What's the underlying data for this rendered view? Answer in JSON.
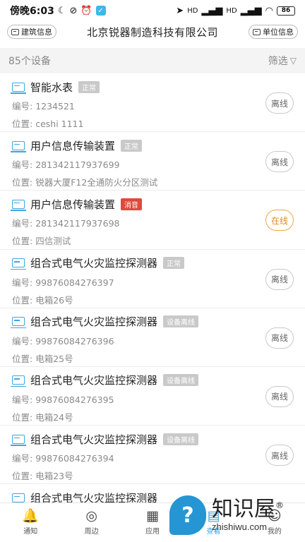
{
  "status_bar": {
    "time": "傍晚6:03",
    "battery": "86",
    "net1": "HD",
    "net2": "HD"
  },
  "header": {
    "left_button": "建筑信息",
    "title": "北京锐器制造科技有限公司",
    "right_button": "单位信息"
  },
  "filter": {
    "count_label": "85个设备",
    "filter_label": "筛选"
  },
  "devices": [
    {
      "name": "智能水表",
      "state": "正常",
      "state_type": "normal",
      "code_label": "编号:",
      "code": "1234521",
      "loc_label": "位置:",
      "location": "ceshi 1111",
      "online": "离线",
      "online_type": "off"
    },
    {
      "name": "用户信息传输装置",
      "state": "正常",
      "state_type": "normal",
      "code_label": "编号:",
      "code": "281342117937699",
      "loc_label": "位置:",
      "location": "锐器大厦F12全通防火分区测试",
      "online": "离线",
      "online_type": "off"
    },
    {
      "name": "用户信息传输装置",
      "state": "消音",
      "state_type": "alarm",
      "code_label": "编号:",
      "code": "281342117937698",
      "loc_label": "位置:",
      "location": "四信测试",
      "online": "在线",
      "online_type": "on"
    },
    {
      "name": "组合式电气火灾监控探测器",
      "state": "正常",
      "state_type": "normal",
      "code_label": "编号:",
      "code": "99876084276397",
      "loc_label": "位置:",
      "location": "电箱26号",
      "online": "离线",
      "online_type": "off"
    },
    {
      "name": "组合式电气火灾监控探测器",
      "state": "设备离线",
      "state_type": "normal",
      "code_label": "编号:",
      "code": "99876084276396",
      "loc_label": "位置:",
      "location": "电箱25号",
      "online": "离线",
      "online_type": "off"
    },
    {
      "name": "组合式电气火灾监控探测器",
      "state": "设备离线",
      "state_type": "normal",
      "code_label": "编号:",
      "code": "99876084276395",
      "loc_label": "位置:",
      "location": "电箱24号",
      "online": "离线",
      "online_type": "off"
    },
    {
      "name": "组合式电气火灾监控探测器",
      "state": "设备离线",
      "state_type": "normal",
      "code_label": "编号:",
      "code": "99876084276394",
      "loc_label": "位置:",
      "location": "电箱23号",
      "online": "离线",
      "online_type": "off"
    },
    {
      "name": "组合式电气火灾监控探测器",
      "state": "",
      "state_type": "normal",
      "code_label": "",
      "code": "",
      "loc_label": "",
      "location": "",
      "online": "",
      "online_type": "off"
    }
  ],
  "bottom_nav": [
    {
      "label": "通知",
      "icon": "bell-icon",
      "glyph": "🔔"
    },
    {
      "label": "周边",
      "icon": "location-icon",
      "glyph": "◎"
    },
    {
      "label": "应用",
      "icon": "grid-icon",
      "glyph": "▦"
    },
    {
      "label": "查看",
      "icon": "view-icon",
      "glyph": "▤"
    },
    {
      "label": "我的",
      "icon": "user-icon",
      "glyph": "☺"
    }
  ],
  "watermark": {
    "cn": "知识屋",
    "en": "zhishiwu.com",
    "reg": "®"
  },
  "colors": {
    "accent": "#3ea6e0",
    "alarm": "#e0493b",
    "online": "#e08a1b",
    "tag_grey": "#c9c9c9"
  }
}
